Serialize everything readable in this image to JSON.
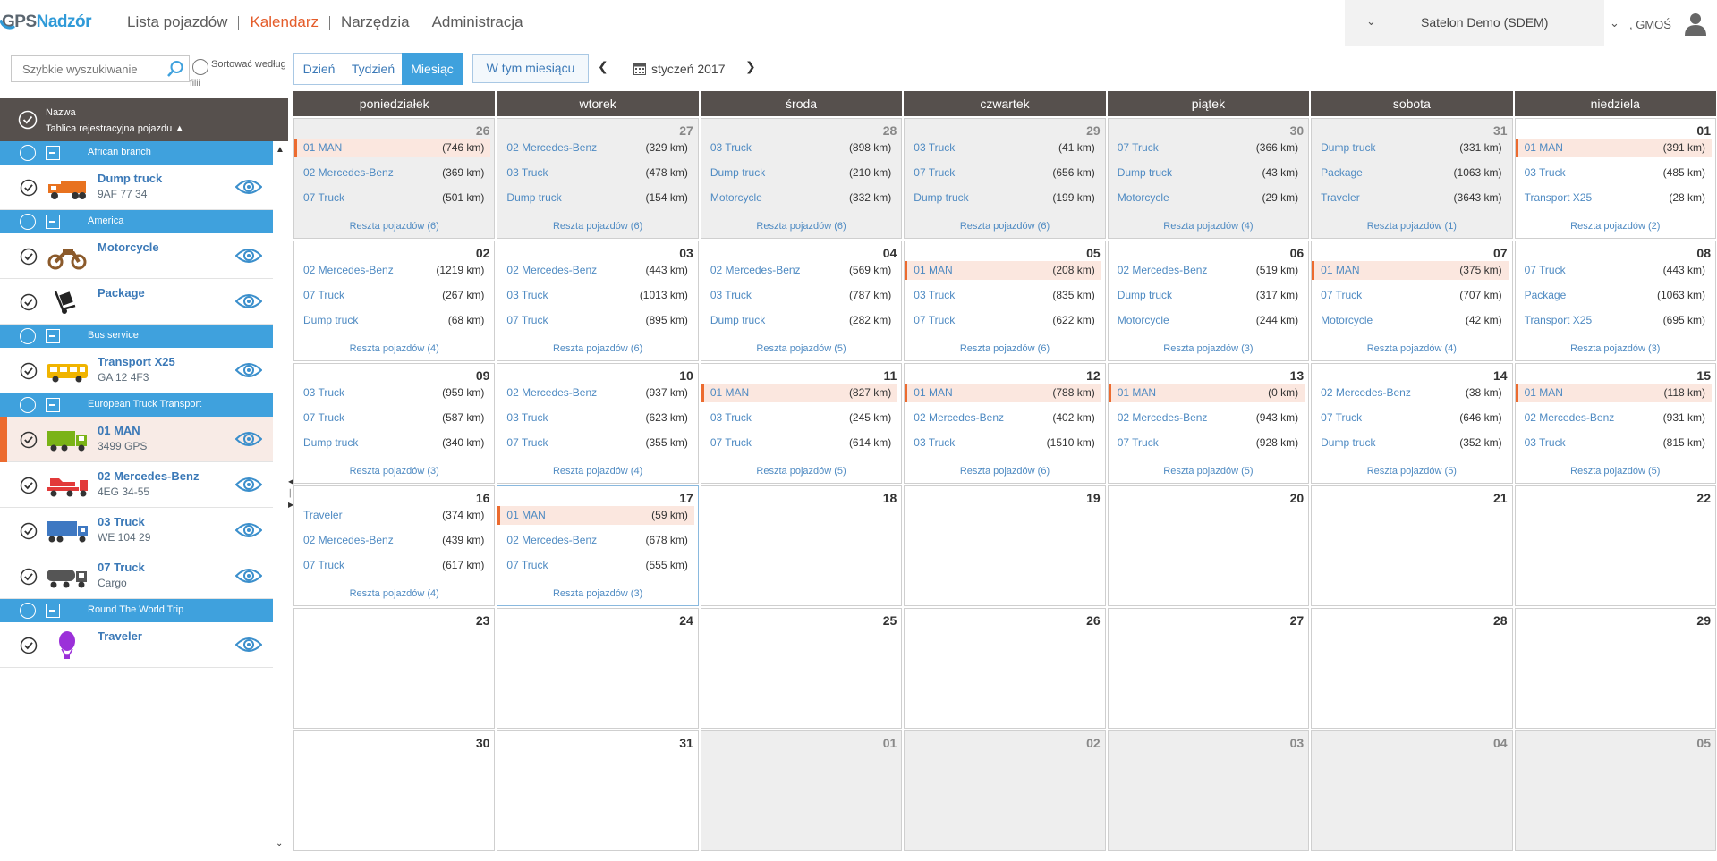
{
  "header": {
    "logo_part1": "GPS",
    "logo_part2": "Nadzór",
    "nav": [
      "Lista pojazdów",
      "Kalendarz",
      "Narzędzia",
      "Administracja"
    ],
    "active_nav": 1,
    "company": "Satelon Demo (SDEM)",
    "user": ", GMOŚ"
  },
  "sidebar": {
    "search_placeholder": "Szybkie wyszukiwanie",
    "sort_label": "Sortować według",
    "sort_label2": "filii",
    "header_name": "Nazwa",
    "header_plate": "Tablica rejestracyjna pojazdu ▲",
    "rows": [
      {
        "type": "group",
        "label": "African branch"
      },
      {
        "type": "vehicle",
        "name": "Dump truck",
        "sub": "9AF 77 34",
        "icon": "dump-truck-icon",
        "color": "#e8721f"
      },
      {
        "type": "group",
        "label": "America"
      },
      {
        "type": "vehicle",
        "name": "Motorcycle",
        "sub": "",
        "icon": "motorcycle-icon",
        "color": "#8b5a2b"
      },
      {
        "type": "vehicle",
        "name": "Package",
        "sub": "",
        "icon": "package-cart-icon",
        "color": "#222222"
      },
      {
        "type": "group",
        "label": "Bus service"
      },
      {
        "type": "vehicle",
        "name": "Transport X25",
        "sub": "GA 12 4F3",
        "icon": "bus-icon",
        "color": "#f0b400"
      },
      {
        "type": "group",
        "label": "European Truck Transport"
      },
      {
        "type": "vehicle",
        "name": "01 MAN",
        "sub": "3499 GPS",
        "icon": "truck-icon",
        "color": "#7ab317",
        "selected": true
      },
      {
        "type": "vehicle",
        "name": "02 Mercedes-Benz",
        "sub": "4EG 34-55",
        "icon": "car-transporter-icon",
        "color": "#e23a3a"
      },
      {
        "type": "vehicle",
        "name": "03 Truck",
        "sub": "WE 104 29",
        "icon": "semi-truck-icon",
        "color": "#3e78c2"
      },
      {
        "type": "vehicle",
        "name": "07 Truck",
        "sub": "Cargo",
        "icon": "tanker-truck-icon",
        "color": "#555555"
      },
      {
        "type": "group",
        "label": "Round The World Trip"
      },
      {
        "type": "vehicle",
        "name": "Traveler",
        "sub": "",
        "icon": "balloon-icon",
        "color": "#9b30d9"
      }
    ]
  },
  "toolbar": {
    "day": "Dzień",
    "week": "Tydzień",
    "month": "Miesiąc",
    "this_month": "W tym miesiącu",
    "month_label": "styczeń 2017"
  },
  "calendar": {
    "days": [
      "poniedziałek",
      "wtorek",
      "środa",
      "czwartek",
      "piątek",
      "sobota",
      "niedziela"
    ],
    "more_prefix": "Reszta pojazdów",
    "highlight_vehicle": "01 MAN",
    "today_index": 22,
    "cells": [
      {
        "d": "26",
        "other": true,
        "e": [
          [
            "01 MAN",
            "(746 km)"
          ],
          [
            "02 Mercedes-Benz",
            "(369 km)"
          ],
          [
            "07 Truck",
            "(501 km)"
          ]
        ],
        "more": "6"
      },
      {
        "d": "27",
        "other": true,
        "e": [
          [
            "02 Mercedes-Benz",
            "(329 km)"
          ],
          [
            "03 Truck",
            "(478 km)"
          ],
          [
            "Dump truck",
            "(154 km)"
          ]
        ],
        "more": "6"
      },
      {
        "d": "28",
        "other": true,
        "e": [
          [
            "03 Truck",
            "(898 km)"
          ],
          [
            "Dump truck",
            "(210 km)"
          ],
          [
            "Motorcycle",
            "(332 km)"
          ]
        ],
        "more": "6"
      },
      {
        "d": "29",
        "other": true,
        "e": [
          [
            "03 Truck",
            "(41 km)"
          ],
          [
            "07 Truck",
            "(656 km)"
          ],
          [
            "Dump truck",
            "(199 km)"
          ]
        ],
        "more": "6"
      },
      {
        "d": "30",
        "other": true,
        "e": [
          [
            "07 Truck",
            "(366 km)"
          ],
          [
            "Dump truck",
            "(43 km)"
          ],
          [
            "Motorcycle",
            "(29 km)"
          ]
        ],
        "more": "4"
      },
      {
        "d": "31",
        "other": true,
        "e": [
          [
            "Dump truck",
            "(331 km)"
          ],
          [
            "Package",
            "(1063 km)"
          ],
          [
            "Traveler",
            "(3643 km)"
          ]
        ],
        "more": "1"
      },
      {
        "d": "01",
        "e": [
          [
            "01 MAN",
            "(391 km)"
          ],
          [
            "03 Truck",
            "(485 km)"
          ],
          [
            "Transport X25",
            "(28 km)"
          ]
        ],
        "more": "2"
      },
      {
        "d": "02",
        "e": [
          [
            "02 Mercedes-Benz",
            "(1219 km)"
          ],
          [
            "07 Truck",
            "(267 km)"
          ],
          [
            "Dump truck",
            "(68 km)"
          ]
        ],
        "more": "4"
      },
      {
        "d": "03",
        "e": [
          [
            "02 Mercedes-Benz",
            "(443 km)"
          ],
          [
            "03 Truck",
            "(1013 km)"
          ],
          [
            "07 Truck",
            "(895 km)"
          ]
        ],
        "more": "6"
      },
      {
        "d": "04",
        "e": [
          [
            "02 Mercedes-Benz",
            "(569 km)"
          ],
          [
            "03 Truck",
            "(787 km)"
          ],
          [
            "Dump truck",
            "(282 km)"
          ]
        ],
        "more": "5"
      },
      {
        "d": "05",
        "e": [
          [
            "01 MAN",
            "(208 km)"
          ],
          [
            "03 Truck",
            "(835 km)"
          ],
          [
            "07 Truck",
            "(622 km)"
          ]
        ],
        "more": "6"
      },
      {
        "d": "06",
        "e": [
          [
            "02 Mercedes-Benz",
            "(519 km)"
          ],
          [
            "Dump truck",
            "(317 km)"
          ],
          [
            "Motorcycle",
            "(244 km)"
          ]
        ],
        "more": "3"
      },
      {
        "d": "07",
        "e": [
          [
            "01 MAN",
            "(375 km)"
          ],
          [
            "07 Truck",
            "(707 km)"
          ],
          [
            "Motorcycle",
            "(42 km)"
          ]
        ],
        "more": "4"
      },
      {
        "d": "08",
        "e": [
          [
            "07 Truck",
            "(443 km)"
          ],
          [
            "Package",
            "(1063 km)"
          ],
          [
            "Transport X25",
            "(695 km)"
          ]
        ],
        "more": "3"
      },
      {
        "d": "09",
        "e": [
          [
            "03 Truck",
            "(959 km)"
          ],
          [
            "07 Truck",
            "(587 km)"
          ],
          [
            "Dump truck",
            "(340 km)"
          ]
        ],
        "more": "3"
      },
      {
        "d": "10",
        "e": [
          [
            "02 Mercedes-Benz",
            "(937 km)"
          ],
          [
            "03 Truck",
            "(623 km)"
          ],
          [
            "07 Truck",
            "(355 km)"
          ]
        ],
        "more": "4"
      },
      {
        "d": "11",
        "e": [
          [
            "01 MAN",
            "(827 km)"
          ],
          [
            "03 Truck",
            "(245 km)"
          ],
          [
            "07 Truck",
            "(614 km)"
          ]
        ],
        "more": "5"
      },
      {
        "d": "12",
        "e": [
          [
            "01 MAN",
            "(788 km)"
          ],
          [
            "02 Mercedes-Benz",
            "(402 km)"
          ],
          [
            "03 Truck",
            "(1510 km)"
          ]
        ],
        "more": "6"
      },
      {
        "d": "13",
        "e": [
          [
            "01 MAN",
            "(0 km)"
          ],
          [
            "02 Mercedes-Benz",
            "(943 km)"
          ],
          [
            "07 Truck",
            "(928 km)"
          ]
        ],
        "more": "5"
      },
      {
        "d": "14",
        "e": [
          [
            "02 Mercedes-Benz",
            "(38 km)"
          ],
          [
            "07 Truck",
            "(646 km)"
          ],
          [
            "Dump truck",
            "(352 km)"
          ]
        ],
        "more": "5"
      },
      {
        "d": "15",
        "e": [
          [
            "01 MAN",
            "(118 km)"
          ],
          [
            "02 Mercedes-Benz",
            "(931 km)"
          ],
          [
            "03 Truck",
            "(815 km)"
          ]
        ],
        "more": "5"
      },
      {
        "d": "16",
        "e": [
          [
            "Traveler",
            "(374 km)"
          ],
          [
            "02 Mercedes-Benz",
            "(439 km)"
          ],
          [
            "07 Truck",
            "(617 km)"
          ]
        ],
        "more": "4"
      },
      {
        "d": "17",
        "e": [
          [
            "01 MAN",
            "(59 km)"
          ],
          [
            "02 Mercedes-Benz",
            "(678 km)"
          ],
          [
            "07 Truck",
            "(555 km)"
          ]
        ],
        "more": "3"
      },
      {
        "d": "18",
        "e": []
      },
      {
        "d": "19",
        "e": []
      },
      {
        "d": "20",
        "e": []
      },
      {
        "d": "21",
        "e": []
      },
      {
        "d": "22",
        "e": []
      },
      {
        "d": "23",
        "e": []
      },
      {
        "d": "24",
        "e": []
      },
      {
        "d": "25",
        "e": []
      },
      {
        "d": "26",
        "e": []
      },
      {
        "d": "27",
        "e": []
      },
      {
        "d": "28",
        "e": []
      },
      {
        "d": "29",
        "e": []
      },
      {
        "d": "30",
        "e": []
      },
      {
        "d": "31",
        "e": []
      },
      {
        "d": "01",
        "other": true,
        "e": []
      },
      {
        "d": "02",
        "other": true,
        "e": []
      },
      {
        "d": "03",
        "other": true,
        "e": []
      },
      {
        "d": "04",
        "other": true,
        "e": []
      },
      {
        "d": "05",
        "other": true,
        "e": []
      }
    ]
  }
}
